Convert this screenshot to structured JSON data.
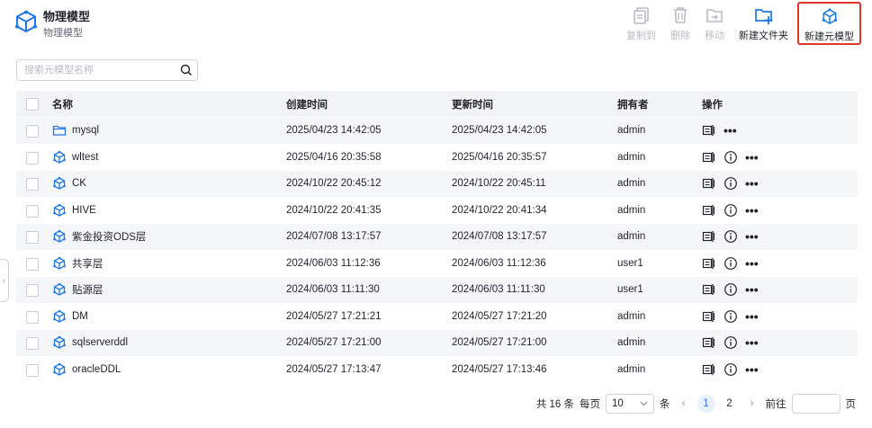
{
  "header": {
    "title": "物理模型",
    "subtitle": "物理模型"
  },
  "toolbar": {
    "copy_to": "复制到",
    "delete": "删除",
    "move": "移动",
    "new_folder": "新建文件夹",
    "new_meta_model": "新建元模型"
  },
  "search": {
    "placeholder": "搜索元模型名称"
  },
  "table": {
    "columns": {
      "name": "名称",
      "created": "创建时间",
      "updated": "更新时间",
      "owner": "拥有者",
      "ops": "操作"
    },
    "rows": [
      {
        "name": "mysql",
        "type": "folder",
        "created": "2025/04/23 14:42:05",
        "updated": "2025/04/23 14:42:05",
        "owner": "admin"
      },
      {
        "name": "wltest",
        "type": "model",
        "created": "2025/04/16 20:35:58",
        "updated": "2025/04/16 20:35:57",
        "owner": "admin"
      },
      {
        "name": "CK",
        "type": "model",
        "created": "2024/10/22 20:45:12",
        "updated": "2024/10/22 20:45:11",
        "owner": "admin"
      },
      {
        "name": "HIVE",
        "type": "model",
        "created": "2024/10/22 20:41:35",
        "updated": "2024/10/22 20:41:34",
        "owner": "admin"
      },
      {
        "name": "紫金投资ODS层",
        "type": "model",
        "created": "2024/07/08 13:17:57",
        "updated": "2024/07/08 13:17:57",
        "owner": "admin"
      },
      {
        "name": "共享层",
        "type": "model",
        "created": "2024/06/03 11:12:36",
        "updated": "2024/06/03 11:12:36",
        "owner": "user1"
      },
      {
        "name": "贴源层",
        "type": "model",
        "created": "2024/06/03 11:11:30",
        "updated": "2024/06/03 11:11:30",
        "owner": "user1"
      },
      {
        "name": "DM",
        "type": "model",
        "created": "2024/05/27 17:21:21",
        "updated": "2024/05/27 17:21:20",
        "owner": "admin"
      },
      {
        "name": "sqlserverddl",
        "type": "model",
        "created": "2024/05/27 17:21:00",
        "updated": "2024/05/27 17:21:00",
        "owner": "admin"
      },
      {
        "name": "oracleDDL",
        "type": "model",
        "created": "2024/05/27 17:13:47",
        "updated": "2024/05/27 17:13:46",
        "owner": "admin"
      }
    ]
  },
  "pager": {
    "total": "共 16 条",
    "per_page_label": "每页",
    "page_size": "10",
    "unit": "条",
    "pages": [
      "1",
      "2"
    ],
    "current_page": "1",
    "goto_label": "前往",
    "page_suffix": "页"
  },
  "colors": {
    "accent": "#3370ff",
    "highlight_border": "#e0352b",
    "disabled": "#b8bcc3",
    "icon_blue": "#1f78e0"
  }
}
